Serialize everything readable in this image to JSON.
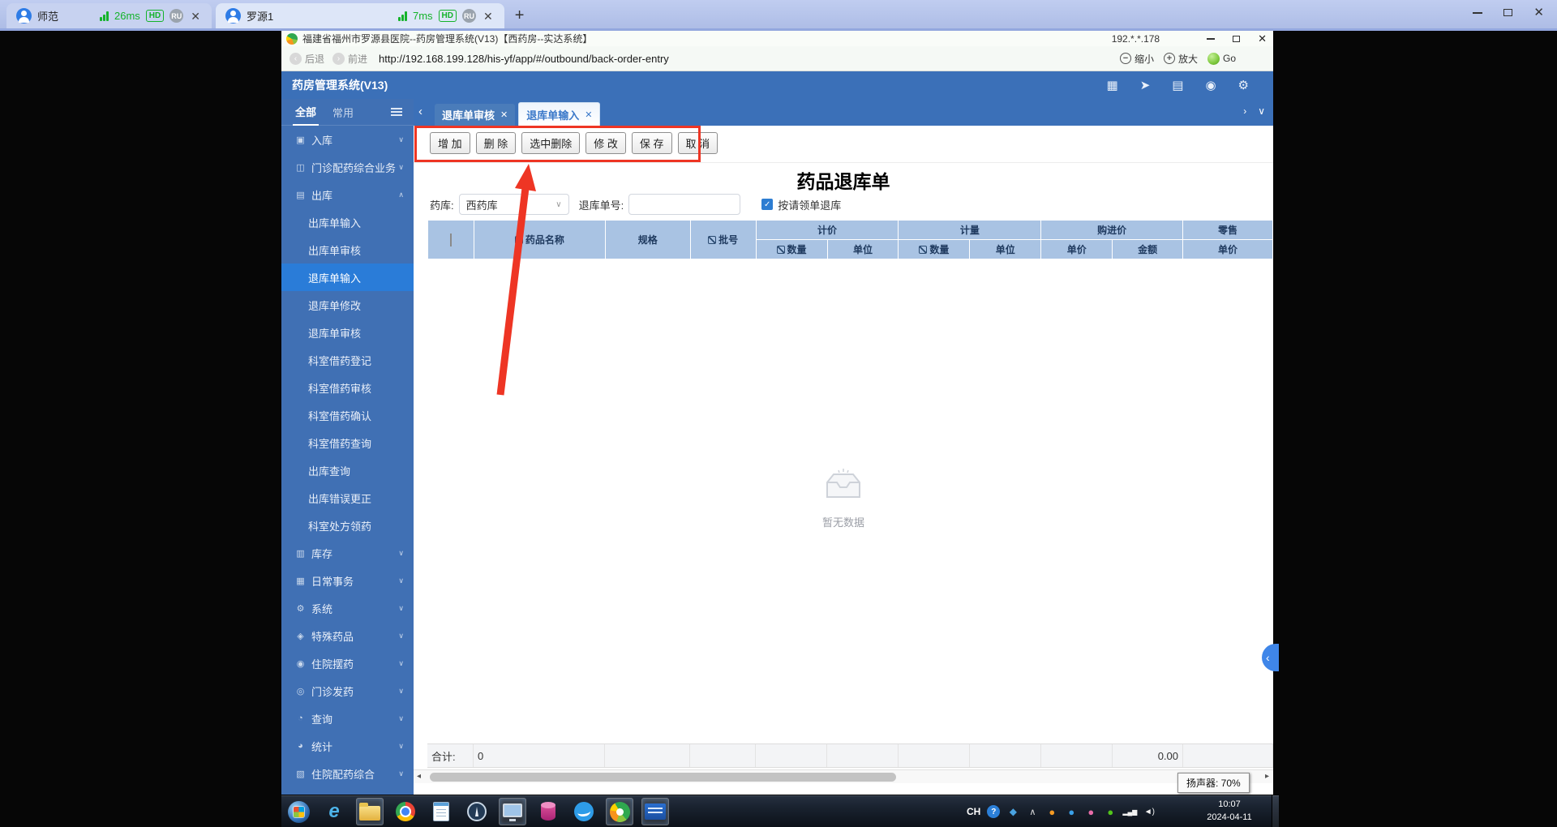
{
  "remote_client": {
    "tabs": [
      {
        "title": "师范",
        "latency": "26ms",
        "hd_badge": "HD",
        "user_badge": "RU",
        "active": false
      },
      {
        "title": "罗源1",
        "latency": "7ms",
        "hd_badge": "HD",
        "user_badge": "RU",
        "active": true
      }
    ],
    "new_tab_label": "+",
    "latency_color": "#14b32a"
  },
  "browser": {
    "window_title": "福建省福州市罗源县医院--药房管理系统(V13)【西药房--实达系统】",
    "remote_ip": "192.*.*.178",
    "back_label": "后退",
    "forward_label": "前进",
    "url": "http://192.168.199.128/his-yf/app/#/outbound/back-order-entry",
    "zoom_out_label": "缩小",
    "zoom_in_label": "放大",
    "go_label": "Go"
  },
  "app": {
    "header": {
      "title": "药房管理系统(V13)",
      "icons": [
        "display-icon",
        "send-icon",
        "panel-icon",
        "eye-icon",
        "gear-icon"
      ]
    },
    "sidebar": {
      "tabs": [
        {
          "label": "全部",
          "active": true
        },
        {
          "label": "常用",
          "active": false
        }
      ],
      "menu": [
        {
          "label": "入库",
          "type": "group",
          "icon": "inbound-icon"
        },
        {
          "label": "门诊配药综合业务",
          "type": "group",
          "icon": "clinic-icon"
        },
        {
          "label": "出库",
          "type": "group",
          "icon": "outbound-icon",
          "expanded": true
        },
        {
          "label": "出库单输入",
          "type": "item"
        },
        {
          "label": "出库单审核",
          "type": "item"
        },
        {
          "label": "退库单输入",
          "type": "item",
          "selected": true
        },
        {
          "label": "退库单修改",
          "type": "item"
        },
        {
          "label": "退库单审核",
          "type": "item"
        },
        {
          "label": "科室借药登记",
          "type": "item"
        },
        {
          "label": "科室借药审核",
          "type": "item"
        },
        {
          "label": "科室借药确认",
          "type": "item"
        },
        {
          "label": "科室借药查询",
          "type": "item"
        },
        {
          "label": "出库查询",
          "type": "item"
        },
        {
          "label": "出库错误更正",
          "type": "item"
        },
        {
          "label": "科室处方领药",
          "type": "item"
        },
        {
          "label": "库存",
          "type": "group",
          "icon": "stock-icon"
        },
        {
          "label": "日常事务",
          "type": "group",
          "icon": "daily-icon"
        },
        {
          "label": "系统",
          "type": "group",
          "icon": "system-icon"
        },
        {
          "label": "特殊药品",
          "type": "group",
          "icon": "special-icon"
        },
        {
          "label": "住院摆药",
          "type": "group",
          "icon": "ward-icon"
        },
        {
          "label": "门诊发药",
          "type": "group",
          "icon": "dispense-icon"
        },
        {
          "label": "查询",
          "type": "group",
          "icon": "query-icon"
        },
        {
          "label": "统计",
          "type": "group",
          "icon": "stats-icon"
        },
        {
          "label": "住院配药综合",
          "type": "group",
          "icon": "inpatient-icon"
        }
      ]
    },
    "content_tabs": [
      {
        "label": "退库单审核",
        "active": false
      },
      {
        "label": "退库单输入",
        "active": true
      }
    ],
    "toolbar": {
      "buttons": [
        "增 加",
        "删 除",
        "选中删除",
        "修 改",
        "保 存",
        "取 消"
      ]
    },
    "page": {
      "title": "药品退库单",
      "warehouse_label": "药库:",
      "warehouse_value": "西药库",
      "order_no_label": "退库单号:",
      "order_no_value": "",
      "by_requisition_label": "按请领单退库",
      "by_requisition_checked": true
    },
    "table": {
      "plain_columns": [
        {
          "label": "药品名称",
          "edit": true
        },
        {
          "label": "规格",
          "edit": false
        },
        {
          "label": "批号",
          "edit": true
        }
      ],
      "groups": [
        {
          "label": "计价",
          "children": [
            {
              "label": "数量",
              "edit": true
            },
            {
              "label": "单位",
              "edit": false
            }
          ]
        },
        {
          "label": "计量",
          "children": [
            {
              "label": "数量",
              "edit": true
            },
            {
              "label": "单位",
              "edit": false
            }
          ]
        },
        {
          "label": "购进价",
          "children": [
            {
              "label": "单价",
              "edit": false
            },
            {
              "label": "金额",
              "edit": false
            }
          ]
        },
        {
          "label": "零售",
          "children": [
            {
              "label": "单价",
              "edit": false
            }
          ]
        }
      ],
      "empty_text": "暂无数据",
      "footer": {
        "label": "合计:",
        "quantity": "0",
        "amount": "0.00"
      }
    },
    "annotation_color": "#ee3524"
  },
  "taskbar": {
    "buttons": [
      "start-button",
      "ie-icon",
      "folder-icon",
      "chrome-icon",
      "notepad-icon",
      "compass-icon",
      "remote-viewer-icon",
      "database-icon",
      "bird-icon",
      "pharmacy-logo-icon",
      "shida-icon"
    ],
    "open_buttons": [
      "folder-icon",
      "remote-viewer-icon",
      "pharmacy-logo-icon",
      "shida-icon"
    ],
    "tray": {
      "ime_label": "CH",
      "icons": [
        "help-icon",
        "shield-icon",
        "chevron-up-icon",
        "orange-app-icon",
        "blue-app-icon",
        "pink-app-icon",
        "green-app-icon",
        "network-icon",
        "volume-icon"
      ]
    },
    "clock": {
      "time": "10:07",
      "date": "2024-04-11"
    },
    "volume_tooltip": "扬声器: 70%"
  }
}
